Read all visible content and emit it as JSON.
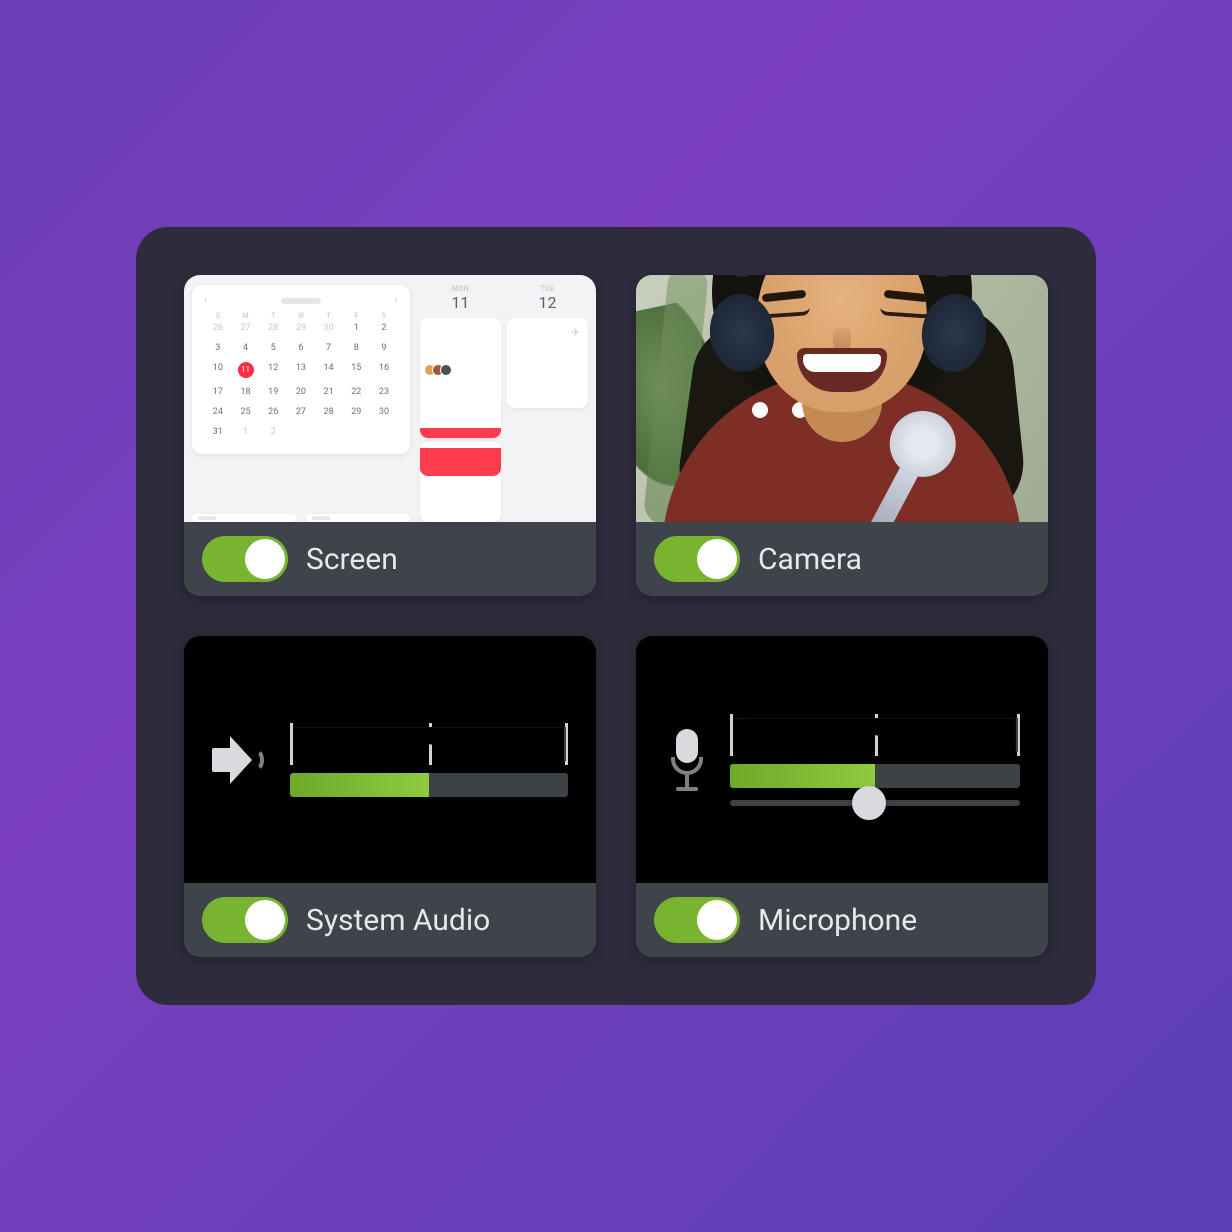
{
  "cards": {
    "screen": {
      "label": "Screen",
      "enabled": true
    },
    "camera": {
      "label": "Camera",
      "enabled": true
    },
    "systemAudio": {
      "label": "System Audio",
      "enabled": true,
      "level_percent": 50
    },
    "microphone": {
      "label": "Microphone",
      "enabled": true,
      "level_percent": 50,
      "gain_slider_percent": 48
    }
  },
  "screenPreview": {
    "calendar": {
      "dow": [
        "S",
        "M",
        "T",
        "W",
        "T",
        "F",
        "S"
      ],
      "leading_muted": [
        26,
        27,
        28,
        29,
        30
      ],
      "days_in_month": 31,
      "active_day": 11,
      "trailing_muted": [
        1,
        2
      ]
    },
    "agenda": {
      "col1": {
        "dow": "MON",
        "day": "11"
      },
      "col2": {
        "dow": "TUE",
        "day": "12"
      }
    }
  },
  "colors": {
    "toggle_on": "#79b430",
    "meter_fill_start": "#6fa82a",
    "meter_fill_end": "#8ecb3f",
    "panel_bg": "#2e2c3c",
    "card_bg": "#3f434a",
    "calendar_accent": "#ff2d40"
  }
}
